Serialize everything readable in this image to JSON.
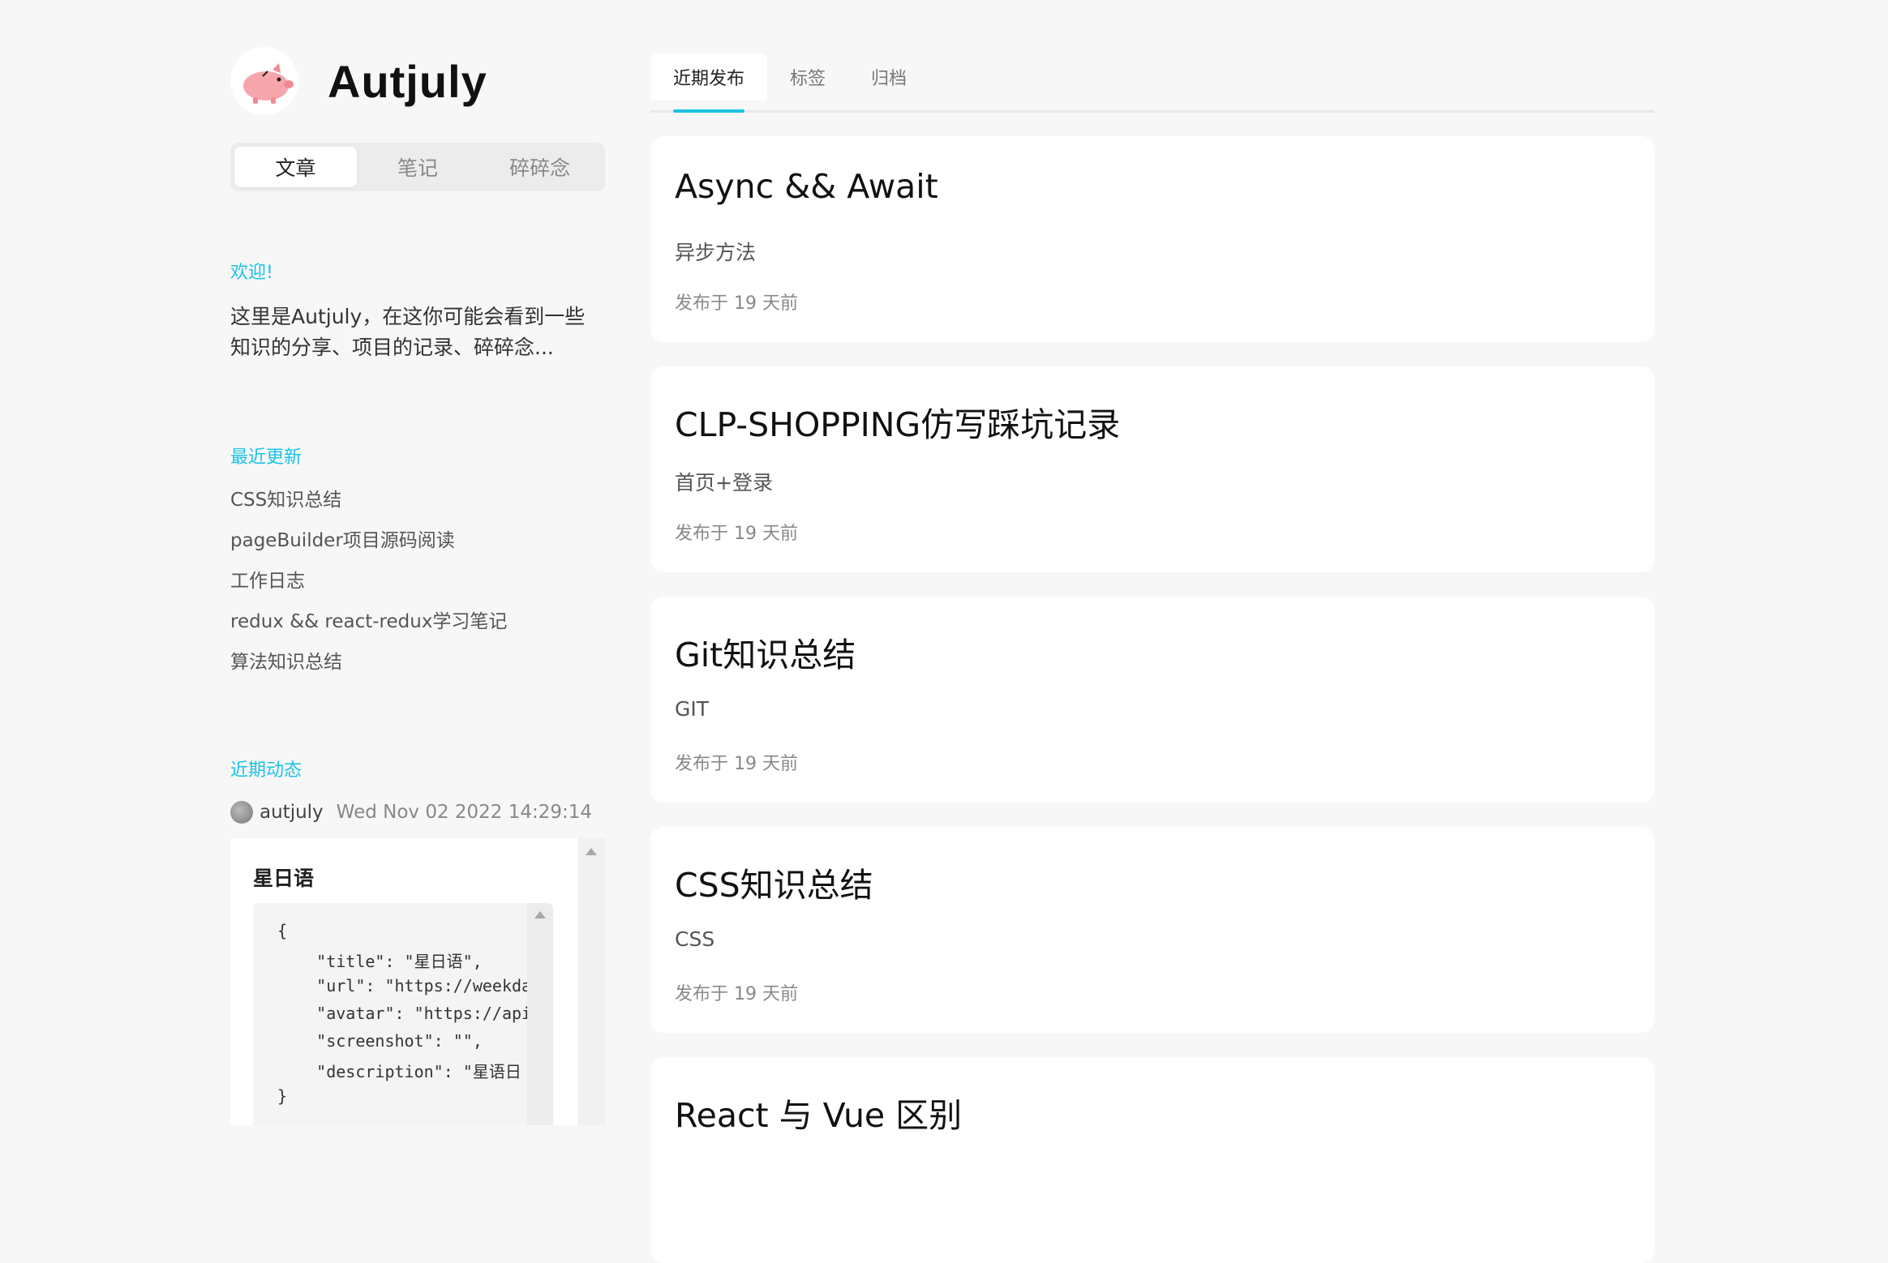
{
  "site": {
    "title": "Autjuly"
  },
  "sidebar": {
    "segments": [
      "文章",
      "笔记",
      "碎碎念"
    ],
    "welcome": {
      "title": "欢迎!",
      "text": "这里是Autjuly，在这你可能会看到一些知识的分享、项目的记录、碎碎念..."
    },
    "recent": {
      "title": "最近更新",
      "items": [
        "CSS知识总结",
        "pageBuilder项目源码阅读",
        "工作日志",
        "redux && react-redux学习笔记",
        "算法知识总结"
      ]
    },
    "activity": {
      "title": "近期动态",
      "user": "autjuly",
      "time": "Wed Nov 02 2022 14:29:14",
      "card_name": "星日语",
      "code": [
        "{",
        "    \"title\": \"星日语\",",
        "    \"url\": \"https://weekda",
        "    \"avatar\": \"https://api",
        "    \"screenshot\": \"\",",
        "    \"description\": \"星语日",
        "}"
      ]
    }
  },
  "tabs": [
    "近期发布",
    "标签",
    "归档"
  ],
  "posts": [
    {
      "title": "Async && Await",
      "desc": "异步方法",
      "date": "发布于 19 天前"
    },
    {
      "title": "CLP-SHOPPING仿写踩坑记录",
      "desc": "首页+登录",
      "date": "发布于 19 天前"
    },
    {
      "title": "Git知识总结",
      "desc": "GIT",
      "date": "发布于 19 天前"
    },
    {
      "title": "CSS知识总结",
      "desc": "CSS",
      "date": "发布于 19 天前"
    },
    {
      "title": "React 与 Vue 区别",
      "desc": "",
      "date": ""
    }
  ],
  "colors": {
    "accent": "#1cc3e6",
    "background": "#f7f7f7",
    "card": "#ffffff"
  }
}
